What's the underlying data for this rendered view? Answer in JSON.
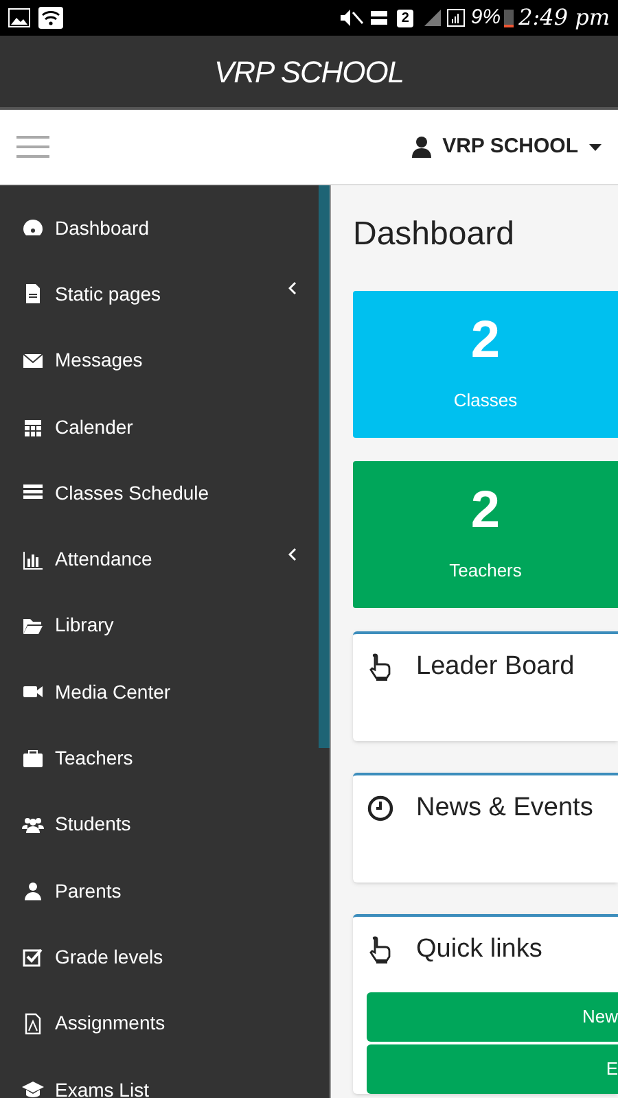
{
  "status_bar": {
    "battery": "9%",
    "time": "2:49 pm",
    "sim": "2"
  },
  "app_title": "VRP SCHOOL",
  "navbar": {
    "user": "VRP SCHOOL"
  },
  "sidebar": {
    "items": [
      {
        "label": "Dashboard",
        "kind": "dashboard",
        "expandable": false
      },
      {
        "label": "Static pages",
        "kind": "file",
        "expandable": true
      },
      {
        "label": "Messages",
        "kind": "envelope",
        "expandable": false
      },
      {
        "label": "Calender",
        "kind": "calendar",
        "expandable": false
      },
      {
        "label": "Classes Schedule",
        "kind": "list",
        "expandable": false
      },
      {
        "label": "Attendance",
        "kind": "chart",
        "expandable": true
      },
      {
        "label": "Library",
        "kind": "folder",
        "expandable": false
      },
      {
        "label": "Media Center",
        "kind": "video",
        "expandable": false
      },
      {
        "label": "Teachers",
        "kind": "briefcase",
        "expandable": false
      },
      {
        "label": "Students",
        "kind": "users",
        "expandable": false
      },
      {
        "label": "Parents",
        "kind": "user",
        "expandable": false
      },
      {
        "label": "Grade levels",
        "kind": "check",
        "expandable": false
      },
      {
        "label": "Assignments",
        "kind": "pdf",
        "expandable": false
      },
      {
        "label": "Exams List",
        "kind": "cap",
        "expandable": false
      }
    ]
  },
  "page_title": "Dashboard",
  "stats": [
    {
      "value": "2",
      "label": "Classes",
      "color": "#00c0ef"
    },
    {
      "value": "2",
      "label": "Teachers",
      "color": "#00a65a"
    }
  ],
  "panels": [
    {
      "title": "Leader Board",
      "kind": "hand"
    },
    {
      "title": "News & Events",
      "kind": "clock"
    },
    {
      "title": "Quick links",
      "kind": "hand",
      "links": [
        "New",
        "E"
      ]
    }
  ]
}
